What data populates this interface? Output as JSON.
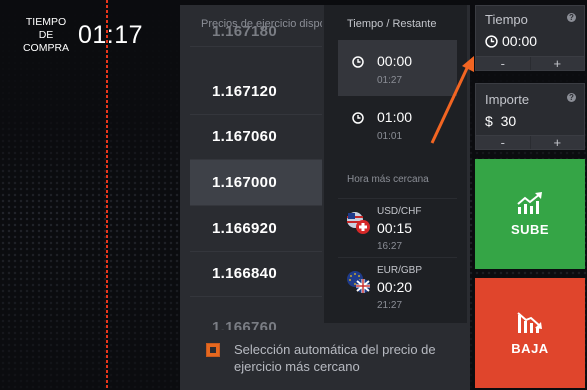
{
  "purchase": {
    "label": "TIEMPO DE COMPRA",
    "time": "01:17"
  },
  "strike": {
    "header": "Precios de ejercicio disponibles",
    "prices": [
      "1.167180",
      "1.167120",
      "1.167060",
      "1.167000",
      "1.166920",
      "1.166840",
      "1.166760"
    ],
    "selected": "1.167000"
  },
  "expiry": {
    "header": "Tiempo / Restante",
    "options": [
      {
        "time": "00:00",
        "remaining": "01:27",
        "selected": true
      },
      {
        "time": "01:00",
        "remaining": "01:01",
        "selected": false
      }
    ],
    "nearest_header": "Hora más cercana",
    "nearest": [
      {
        "pair": "USD/CHF",
        "time": "00:15",
        "remaining": "16:27"
      },
      {
        "pair": "EUR/GBP",
        "time": "00:20",
        "remaining": "21:27"
      }
    ]
  },
  "auto_select": {
    "label": "Selección automática del precio de ejercicio más cercano",
    "checked": true
  },
  "sidebar": {
    "time": {
      "label": "Tiempo",
      "value": "00:00",
      "minus": "-",
      "plus": "+"
    },
    "amount": {
      "label": "Importe",
      "value": "$  30",
      "minus": "-",
      "plus": "+"
    },
    "up_button": "SUBE",
    "down_button": "BAJA"
  },
  "colors": {
    "up": "#35a546",
    "down": "#e0452c",
    "accent": "#e6681f",
    "panel": "#2a2c31"
  },
  "icons": [
    "clock-icon",
    "help-icon",
    "trend-up-icon",
    "trend-down-icon",
    "usd-flag-icon",
    "chf-flag-icon",
    "eur-flag-icon",
    "gbp-flag-icon"
  ]
}
